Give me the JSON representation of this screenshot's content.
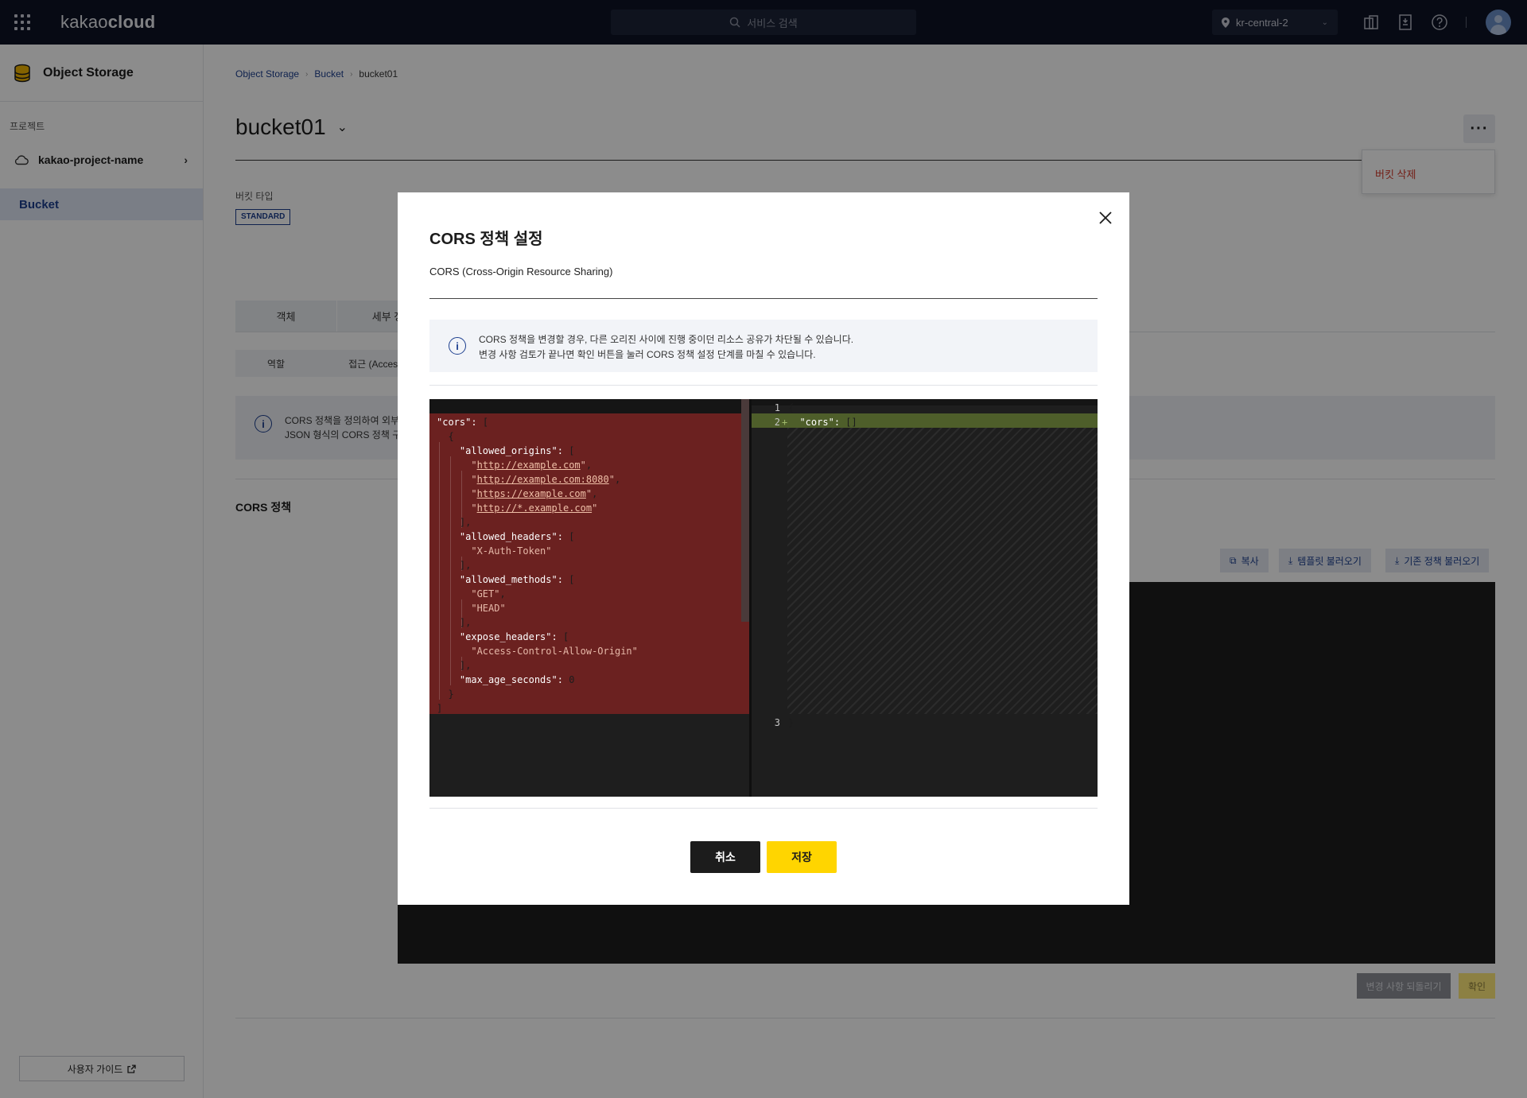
{
  "brand": {
    "logo_light": "kakao",
    "logo_bold": "cloud"
  },
  "topbar": {
    "search_placeholder": "서비스 검색",
    "region": "kr-central-2"
  },
  "sidebar": {
    "service_title": "Object Storage",
    "project_label": "프로젝트",
    "project_name": "kakao-project-name",
    "active_item": "Bucket",
    "guide_button": "사용자 가이드"
  },
  "breadcrumb": [
    "Object Storage",
    "Bucket",
    "bucket01"
  ],
  "page": {
    "title": "bucket01",
    "more_menu_delete": "버킷 삭제",
    "bucket_type_label": "버킷 타입",
    "bucket_type_badge": "STANDARD",
    "tabs": [
      "객체",
      "세부 정"
    ],
    "subtabs": [
      "역할",
      "접근 (Access-Co"
    ],
    "info_line1": "CORS 정책을 정의하여 외부",
    "info_line2": "JSON 형식의 CORS 정책 구",
    "cors_section": "CORS 정책",
    "copy_button": "복사",
    "template_button": "템플릿 불러오기",
    "load_existing_button": "기존 정책 불러오기",
    "revert_button": "변경 사항 되돌리기",
    "confirm_button": "확인"
  },
  "modal": {
    "title": "CORS 정책 설정",
    "subtitle": "CORS (Cross-Origin Resource Sharing)",
    "info_line1": "CORS 정책을 변경할 경우, 다른 오리진 사이에 진행 중이던 리소스 공유가 차단될 수 있습니다.",
    "info_line2": "변경 사항 검토가 끝나면 확인 버튼을 눌러 CORS 정책 설정 단계를 마칠 수 있습니다.",
    "cancel_button": "취소",
    "save_button": "저장"
  },
  "diff": {
    "original_lines": [
      "\"cors\": [",
      "  {",
      "    \"allowed_origins\": [",
      "      \"http://example.com\",",
      "      \"http://example.com:8080\",",
      "      \"https://example.com\",",
      "      \"http://*.example.com\"",
      "    ],",
      "    \"allowed_headers\": [",
      "      \"X-Auth-Token\"",
      "    ],",
      "    \"allowed_methods\": [",
      "      \"GET\",",
      "      \"HEAD\"",
      "    ],",
      "    \"expose_headers\": [",
      "      \"Access-Control-Allow-Origin\"",
      "    ],",
      "    \"max_age_seconds\": 0",
      "  }",
      "]"
    ],
    "modified_lines": [
      {
        "num": "1",
        "marker": "",
        "text": "{"
      },
      {
        "num": "2",
        "marker": "+",
        "text": "  \"cors\": []"
      },
      {
        "num": "3",
        "marker": "",
        "text": "}"
      }
    ]
  },
  "colors": {
    "accent_yellow": "#ffd500",
    "removed": "#6b2120",
    "added": "#4e5e2a",
    "link_blue": "#1d3f8f",
    "danger": "#d23a2a"
  }
}
